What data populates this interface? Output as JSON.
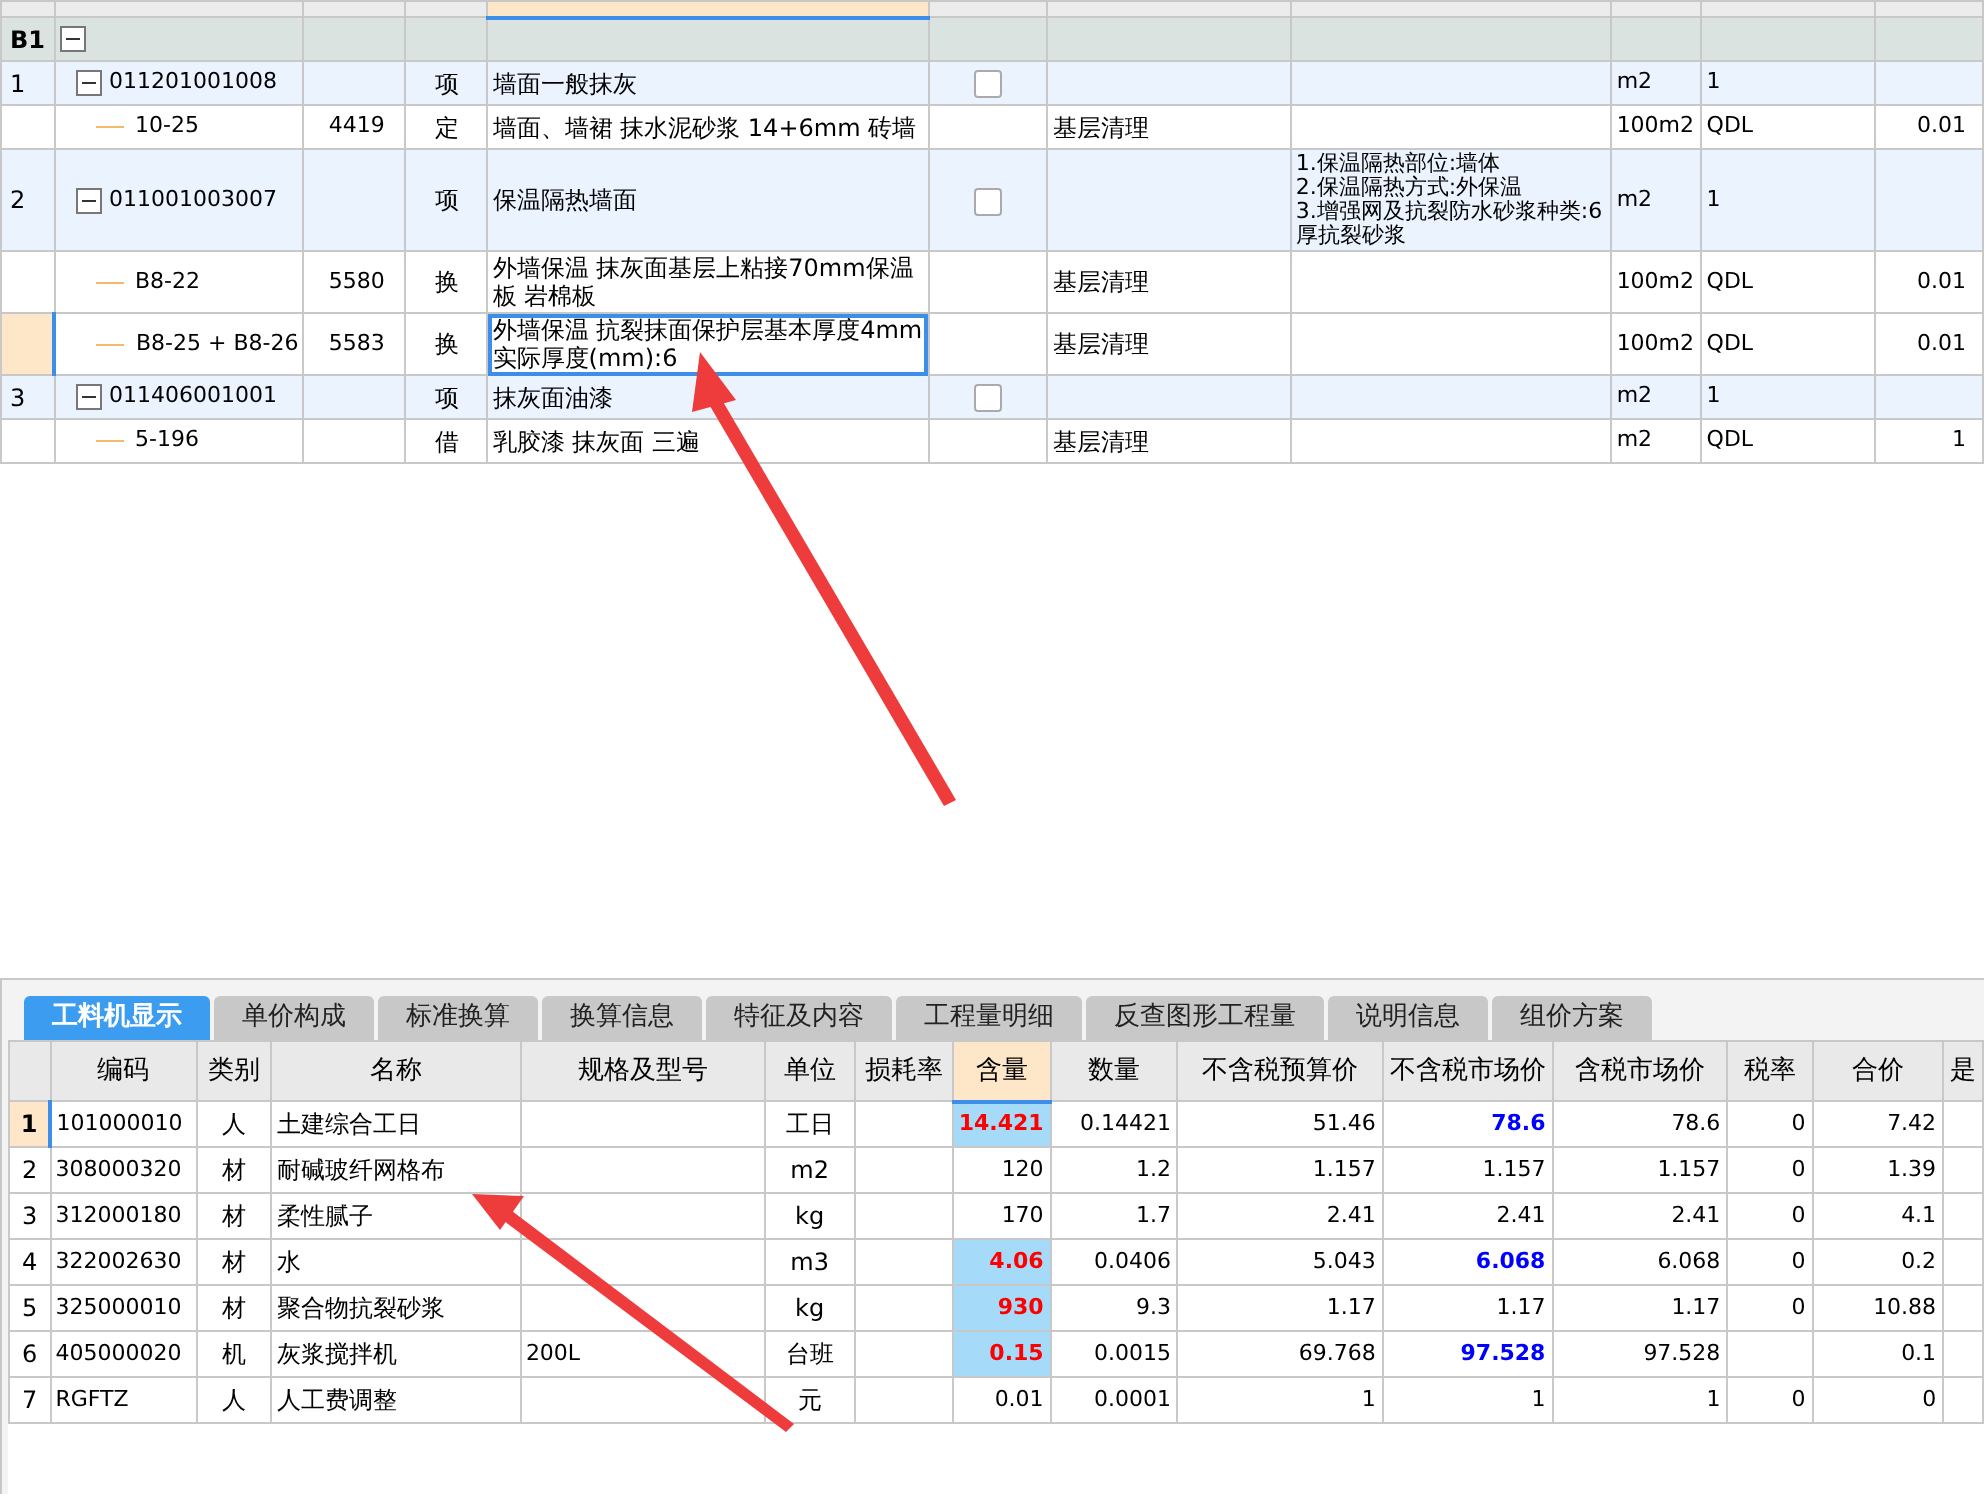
{
  "top_table": {
    "rows": [
      {
        "row_no": "B1",
        "expanded": true,
        "selected": false,
        "children": [
          {
            "row_no": "1",
            "code": "011201001008",
            "type": "项",
            "name": "墙面一般抹灰",
            "checked": false,
            "unit": "m2",
            "column_9": "1",
            "expanded": true,
            "selected": false,
            "children": [
              {
                "code": "10-25",
                "number": "4419",
                "type": "定",
                "name": "墙面、墙裙 抹水泥砂浆 14+6mm 砖墙",
                "column_6": "基层清理",
                "unit": "100m2",
                "column_9": "QDL",
                "column_10": "0.01",
                "selected": false
              }
            ]
          },
          {
            "row_no": "2",
            "code": "011001003007",
            "type": "项",
            "name": "保温隔热墙面",
            "checked": false,
            "column_7": "1.保温隔热部位:墙体\n2.保温隔热方式:外保温\n3.增强网及抗裂防水砂浆种类:6厚抗裂砂浆",
            "unit": "m2",
            "column_9": "1",
            "expanded": true,
            "selected": false,
            "children": [
              {
                "code": "B8-22",
                "number": "5580",
                "type": "换",
                "name": "外墙保温 抹灰面基层上粘接70mm保温板 岩棉板",
                "column_6": "基层清理",
                "unit": "100m2",
                "column_9": "QDL",
                "column_10": "0.01",
                "selected": false
              },
              {
                "code": "B8-25 + B8-26",
                "number": "5583",
                "type": "换",
                "name": "外墙保温 抗裂抹面保护层基本厚度4mm 实际厚度(mm):6",
                "column_6": "基层清理",
                "unit": "100m2",
                "column_9": "QDL",
                "column_10": "0.01",
                "selected": true
              }
            ]
          },
          {
            "row_no": "3",
            "code": "011406001001",
            "type": "项",
            "name": "抹灰面油漆",
            "checked": false,
            "unit": "m2",
            "column_9": "1",
            "expanded": true,
            "selected": false,
            "children": [
              {
                "code": "5-196",
                "type": "借",
                "name": "乳胶漆 抹灰面 三遍",
                "column_6": "基层清理",
                "unit": "m2",
                "column_9": "QDL",
                "column_10": "1",
                "selected": false
              }
            ]
          }
        ]
      }
    ]
  },
  "tabs": [
    {
      "label": "工料机显示",
      "selected": true
    },
    {
      "label": "单价构成",
      "selected": false
    },
    {
      "label": "标准换算",
      "selected": false
    },
    {
      "label": "换算信息",
      "selected": false
    },
    {
      "label": "特征及内容",
      "selected": false
    },
    {
      "label": "工程量明细",
      "selected": false
    },
    {
      "label": "反查图形工程量",
      "selected": false
    },
    {
      "label": "说明信息",
      "selected": false
    },
    {
      "label": "组价方案",
      "selected": false
    }
  ],
  "resource_table": {
    "columns": [
      "编码",
      "类别",
      "名称",
      "规格及型号",
      "单位",
      "损耗率",
      "含量",
      "数量",
      "不含税预算价",
      "不含税市场价",
      "含税市场价",
      "税率",
      "合价",
      "是"
    ],
    "rows": [
      {
        "row_no": "1",
        "selected": true,
        "content_modified": true,
        "price_modified": true,
        "cells": [
          "101000010",
          "人",
          "土建综合工日",
          "",
          "工日",
          "",
          "14.421",
          "0.14421",
          "51.46",
          "78.6",
          "78.6",
          "0",
          "7.42",
          ""
        ]
      },
      {
        "row_no": "2",
        "selected": false,
        "content_modified": false,
        "price_modified": false,
        "cells": [
          "308000320",
          "材",
          "耐碱玻纤网格布",
          "",
          "m2",
          "",
          "120",
          "1.2",
          "1.157",
          "1.157",
          "1.157",
          "0",
          "1.39",
          ""
        ]
      },
      {
        "row_no": "3",
        "selected": false,
        "content_modified": false,
        "price_modified": false,
        "cells": [
          "312000180",
          "材",
          "柔性腻子",
          "",
          "kg",
          "",
          "170",
          "1.7",
          "2.41",
          "2.41",
          "2.41",
          "0",
          "4.1",
          ""
        ]
      },
      {
        "row_no": "4",
        "selected": false,
        "content_modified": true,
        "price_modified": true,
        "cells": [
          "322002630",
          "材",
          "水",
          "",
          "m3",
          "",
          "4.06",
          "0.0406",
          "5.043",
          "6.068",
          "6.068",
          "0",
          "0.2",
          ""
        ]
      },
      {
        "row_no": "5",
        "selected": false,
        "content_modified": true,
        "price_modified": false,
        "cells": [
          "325000010",
          "材",
          "聚合物抗裂砂浆",
          "",
          "kg",
          "",
          "930",
          "9.3",
          "1.17",
          "1.17",
          "1.17",
          "0",
          "10.88",
          ""
        ]
      },
      {
        "row_no": "6",
        "selected": false,
        "content_modified": true,
        "price_modified": true,
        "cells": [
          "405000020",
          "机",
          "灰浆搅拌机",
          "200L",
          "台班",
          "",
          "0.15",
          "0.0015",
          "69.768",
          "97.528",
          "97.528",
          "",
          "0.1",
          ""
        ]
      },
      {
        "row_no": "7",
        "selected": false,
        "content_modified": false,
        "price_modified": false,
        "cells": [
          "RGFTZ",
          "人",
          "人工费调整",
          "",
          "元",
          "",
          "0.01",
          "0.0001",
          "1",
          "1",
          "1",
          "0",
          "0",
          ""
        ]
      }
    ]
  }
}
